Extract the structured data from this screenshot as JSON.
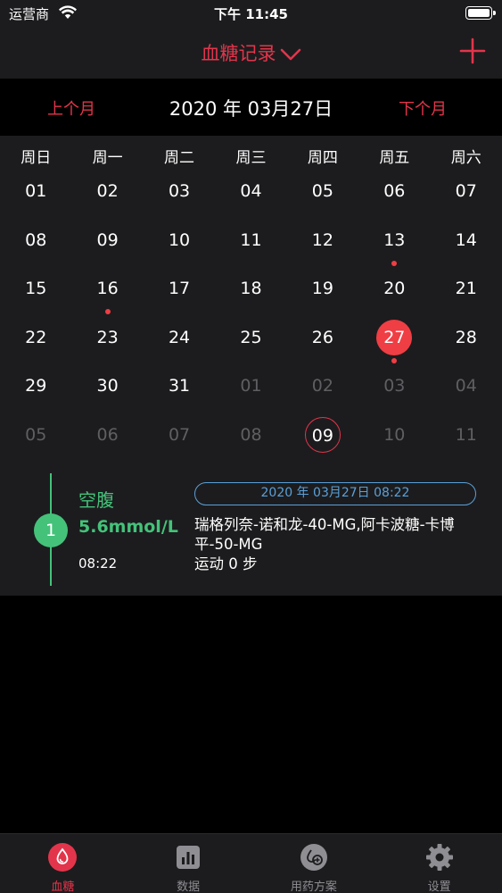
{
  "status_bar": {
    "carrier": "运营商",
    "time": "下午 11:45"
  },
  "nav": {
    "title": "血糖记录"
  },
  "month_bar": {
    "prev": "上个月",
    "current": "2020 年 03月27日",
    "next": "下个月"
  },
  "calendar": {
    "weekdays": [
      "周日",
      "周一",
      "周二",
      "周三",
      "周四",
      "周五",
      "周六"
    ],
    "weeks": [
      [
        "01",
        "02",
        "03",
        "04",
        "05",
        "06",
        "07"
      ],
      [
        "08",
        "09",
        "10",
        "11",
        "12",
        "13",
        "14"
      ],
      [
        "15",
        "16",
        "17",
        "18",
        "19",
        "20",
        "21"
      ],
      [
        "22",
        "23",
        "24",
        "25",
        "26",
        "27",
        "28"
      ],
      [
        "29",
        "30",
        "31",
        "01",
        "02",
        "03",
        "04"
      ],
      [
        "05",
        "06",
        "07",
        "08",
        "09",
        "10",
        "11"
      ]
    ]
  },
  "record": {
    "index": "1",
    "type": "空腹",
    "value": "5.6mmol/L",
    "time": "08:22",
    "datetime": "2020 年 03月27日 08:22",
    "medication": "瑞格列奈-诺和龙-40-MG,阿卡波糖-卡博平-50-MG",
    "exercise": "运动 0 步"
  },
  "tabs": [
    {
      "label": "血糖",
      "icon": "blood-drop-icon"
    },
    {
      "label": "数据",
      "icon": "bar-chart-icon"
    },
    {
      "label": "用药方案",
      "icon": "medicine-icon"
    },
    {
      "label": "设置",
      "icon": "gear-icon"
    }
  ],
  "colors": {
    "accent": "#e2354b",
    "selected_day": "#ef3e44",
    "record_green": "#44c27a",
    "datetime_blue": "#5aa0d8",
    "panel": "#1c1c1e"
  }
}
